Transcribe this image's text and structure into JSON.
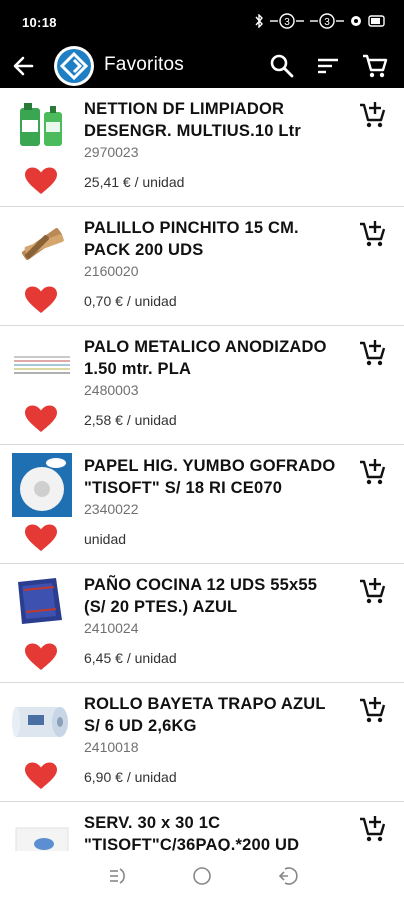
{
  "status_bar": {
    "time": "10:18"
  },
  "app_bar": {
    "title": "Favoritos"
  },
  "products": [
    {
      "name": "NETTION DF LIMPIADOR DESENGR. MULTIUS.10 Ltr",
      "code": "2970023",
      "price": "25,41 € / unidad",
      "image": "green-cleaner-bottles"
    },
    {
      "name": "PALILLO PINCHITO 15 CM. PACK 200 UDS",
      "code": "2160020",
      "price": "0,70 € / unidad",
      "image": "wooden-skewers"
    },
    {
      "name": "PALO METALICO ANODIZADO 1.50 mtr. PLA",
      "code": "2480003",
      "price": "2,58 € / unidad",
      "image": "metal-poles"
    },
    {
      "name": "PAPEL HIG. YUMBO GOFRADO \"TISOFT\" S/ 18 RI CE070",
      "code": "2340022",
      "price": "unidad",
      "image": "toilet-paper-roll"
    },
    {
      "name": "PAÑO COCINA 12 UDS 55x55 (S/ 20 PTES.) AZUL",
      "code": "2410024",
      "price": "6,45 € / unidad",
      "image": "blue-kitchen-cloth"
    },
    {
      "name": "ROLLO BAYETA TRAPO AZUL S/ 6 UD 2,6KG",
      "code": "2410018",
      "price": "6,90 € / unidad",
      "image": "cloth-roll"
    },
    {
      "name": "SERV. 30 x 30 1C \"TISOFT\"C/36PAQ.*200 UD",
      "code": "",
      "price": "",
      "image": "napkins"
    }
  ],
  "colors": {
    "bar": "#000000",
    "heart": "#e53935",
    "text": "#111111",
    "muted": "#707070"
  }
}
